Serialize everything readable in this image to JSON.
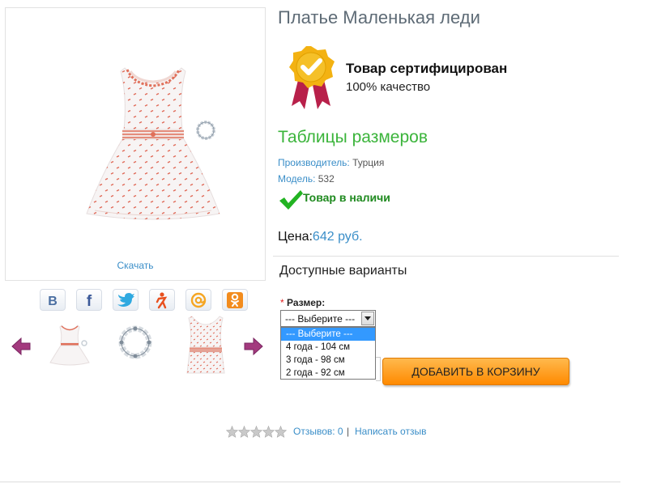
{
  "product": {
    "title": "Платье Маленькая леди",
    "download_label": "Скачать",
    "certificate": {
      "title": "Товар сертифицирован",
      "subtitle": "100% качество"
    },
    "size_tables_label": "Таблицы размеров",
    "manufacturer": {
      "label": "Производитель:",
      "value": "Турция"
    },
    "model": {
      "label": "Модель:",
      "value": "532"
    },
    "stock_status": "Товар в наличи",
    "price": {
      "label": "Цена:",
      "value": "642 руб."
    }
  },
  "social": [
    "vk-icon",
    "facebook-icon",
    "twitter-icon",
    "odnoklassniki-man-icon",
    "mail-at-icon",
    "odnoklassniki-icon"
  ],
  "variants": {
    "title": "Доступные варианты",
    "size": {
      "required_mark": "*",
      "label": "Размер:",
      "selected": "--- Выберите ---",
      "options": [
        "--- Выберите ---",
        "4 года - 104 см",
        "3 года - 98 см",
        "2 года - 92 см"
      ],
      "highlighted_index": 0
    }
  },
  "cart": {
    "add_label": "ДОБАВИТЬ В КОРЗИНУ"
  },
  "reviews": {
    "rating": 0,
    "max_rating": 5,
    "count_label": "Отзывов: 0",
    "separator": "|",
    "write_label": "Написать отзыв"
  },
  "colors": {
    "link_blue": "#3a8ec8",
    "green": "#3bb43b",
    "orange_button": "#ff8a00",
    "title_gray": "#5e6b76",
    "nav_arrow": "#a33a7e"
  }
}
